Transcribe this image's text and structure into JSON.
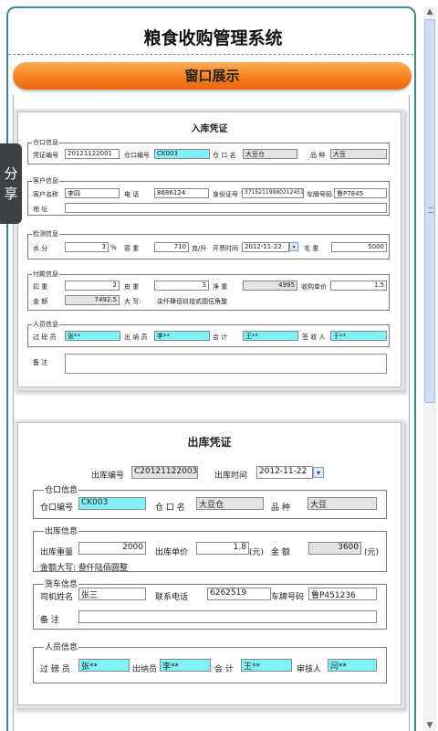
{
  "app": {
    "title": "粮食收购管理系统",
    "banner": "窗口展示",
    "share": "分享"
  },
  "entry": {
    "title": "入库凭证",
    "ckinfo": {
      "legend": "仓口信息",
      "voucher_no_label": "凭证编号",
      "voucher_no": "20121122001",
      "warehouse_no_label": "仓口编号",
      "warehouse_no": "CK003",
      "warehouse_name_label": "仓 口 名",
      "warehouse_name": "大豆仓",
      "variety_label": "品    种",
      "variety": "大豆"
    },
    "customer": {
      "legend": "客户信息",
      "name_label": "客户名称",
      "name": "李四",
      "phone_label": "电    话",
      "phone": "8686124",
      "id_label": "身份证号",
      "id": "371521198802124512",
      "plate_label": "车牌号码",
      "plate": "鲁P7845",
      "address_label": "地    址",
      "address": ""
    },
    "inspect": {
      "legend": "检测信息",
      "moisture_label": "水    分",
      "moisture": "3",
      "moisture_unit": "%",
      "volume_label": "容    重",
      "volume": "710",
      "volume_unit": "克/升",
      "time_label": "开票时间",
      "time": "2012-11-22",
      "gross_label": "毛    重",
      "gross": "5000"
    },
    "payment": {
      "legend": "付款信息",
      "deduct_label": "扣    重",
      "deduct": "2",
      "tare_label": "皮    重",
      "tare": "3",
      "net_label": "净    重",
      "net": "4995",
      "price_label": "收购单价",
      "price": "1.5",
      "amount_label": "金    额",
      "amount": "7492.5",
      "upper_label": "大    写:",
      "upper": "柒仟肆佰玖拾贰圆伍角整"
    },
    "staff": {
      "legend": "人员信息",
      "weigher_label": "过 磅 员",
      "weigher": "张**",
      "cashier_label": "出 纳 员",
      "cashier": "李**",
      "accountant_label": "会    计",
      "accountant": "王**",
      "signer_label": "签 收 人",
      "signer": "于**"
    },
    "remark_label": "备    注"
  },
  "exit": {
    "title": "出库凭证",
    "no_label": "出库编号",
    "no": "C20121122003",
    "time_label": "出库时间",
    "time": "2012-11-22",
    "ckinfo": {
      "legend": "仓口信息",
      "warehouse_no_label": "仓口编号",
      "warehouse_no": "CK003",
      "warehouse_name_label": "仓 口 名",
      "warehouse_name": "大豆仓",
      "variety_label": "品    种",
      "variety": "大豆"
    },
    "outinfo": {
      "legend": "出库信息",
      "weight_label": "出库重量",
      "weight": "2000",
      "price_label": "出库单价",
      "price": "1.8",
      "price_unit": "(元)",
      "amount_label": "金    额",
      "amount": "3600",
      "amount_unit": "(元)",
      "upper": "金额大写: 叁仟陆佰圆整"
    },
    "truck": {
      "legend": "货车信息",
      "driver_label": "司机姓名",
      "driver": "张三",
      "phone_label": "联系电话",
      "phone": "6262519",
      "plate_label": "车牌号码",
      "plate": "鲁P451236",
      "remark_label": "备    注"
    },
    "staff": {
      "legend": "人员信息",
      "weigher_label": "过 磅 员",
      "weigher": "张**",
      "cashier_label": "出纳员",
      "cashier": "李**",
      "accountant_label": "会  计",
      "accountant": "王**",
      "auditor_label": "审核人",
      "auditor": "闫**"
    }
  }
}
